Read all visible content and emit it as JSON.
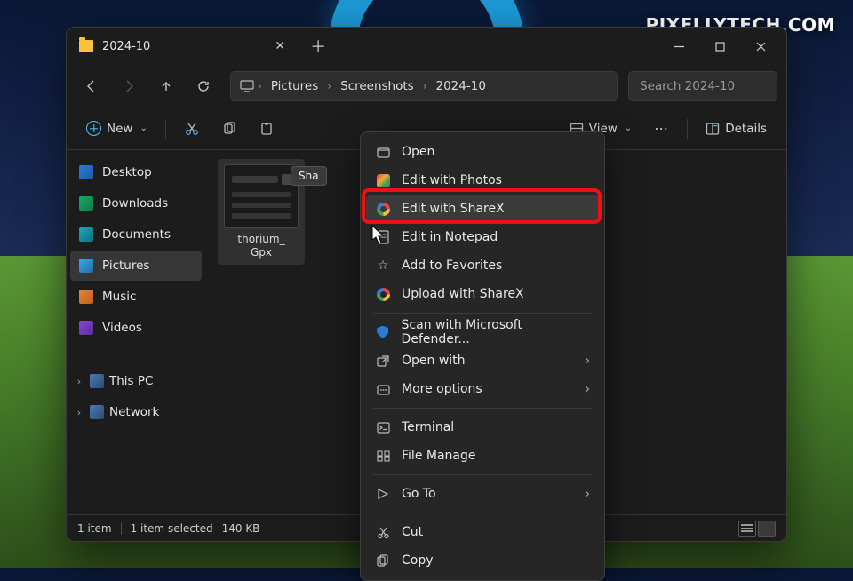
{
  "watermark": "PIXELLYTECH.COM",
  "window": {
    "title": "2024-10",
    "breadcrumb": [
      "Pictures",
      "Screenshots",
      "2024-10"
    ],
    "search_placeholder": "Search 2024-10"
  },
  "toolbar": {
    "new": "New",
    "view": "View",
    "details": "Details"
  },
  "sidebar": {
    "items": [
      {
        "label": "Desktop"
      },
      {
        "label": "Downloads"
      },
      {
        "label": "Documents"
      },
      {
        "label": "Pictures"
      },
      {
        "label": "Music"
      },
      {
        "label": "Videos"
      }
    ],
    "groups": [
      {
        "label": "This PC"
      },
      {
        "label": "Network"
      }
    ]
  },
  "content": {
    "thumb_caption_l1": "thorium_",
    "thumb_caption_l2": "Gpx",
    "tooltip": "Sha"
  },
  "status": {
    "count": "1 item",
    "selected": "1 item selected",
    "size": "140 KB"
  },
  "context_menu": {
    "items": [
      {
        "label": "Open",
        "icon": "open"
      },
      {
        "label": "Edit with Photos",
        "icon": "photos"
      },
      {
        "label": "Edit with ShareX",
        "icon": "sharex",
        "highlight": true
      },
      {
        "label": "Edit in Notepad",
        "icon": "notepad"
      },
      {
        "label": "Add to Favorites",
        "icon": "star"
      },
      {
        "label": "Upload with ShareX",
        "icon": "sharex"
      }
    ],
    "items2": [
      {
        "label": "Scan with Microsoft Defender...",
        "icon": "shield"
      },
      {
        "label": "Open with",
        "icon": "openwith",
        "submenu": true
      },
      {
        "label": "More options",
        "icon": "more",
        "submenu": true
      }
    ],
    "items3": [
      {
        "label": "Terminal",
        "icon": "terminal"
      },
      {
        "label": "File Manage",
        "icon": "filemgr"
      }
    ],
    "items4": [
      {
        "label": "Go To",
        "icon": "goto",
        "submenu": true
      }
    ],
    "items5": [
      {
        "label": "Cut",
        "icon": "cut"
      },
      {
        "label": "Copy",
        "icon": "copy"
      }
    ]
  }
}
